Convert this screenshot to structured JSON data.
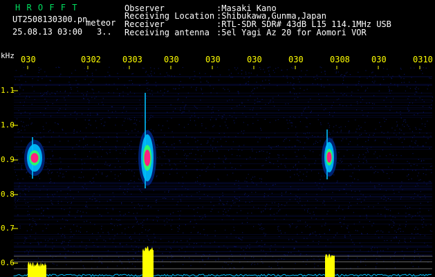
{
  "header": {
    "program": "H R O F F T",
    "filename": "UT2508130300.pn",
    "mode": "meteor",
    "datetime": "25.08.13 03:00",
    "count": "3..",
    "info_labels": [
      "Observer",
      "Receiving Location",
      "Receiver",
      "Receiving antenna"
    ],
    "info_values": [
      ":Masaki Kano",
      ":Shibukawa,Gunma,Japan",
      ":RTL-SDR SDR# 43dB L15 114.1MHz USB",
      ":5el Yagi Az 20 for Aomori VOR"
    ]
  },
  "axis": {
    "unit": "kHz",
    "y_ticks": [
      "1.1",
      "1.0",
      "0.9",
      "0.8",
      "0.7",
      "0.6"
    ],
    "time_ticks": [
      "030",
      "0302",
      "0303",
      "030",
      "030",
      "030",
      "030",
      "0308",
      "030",
      "0310"
    ]
  },
  "colors": {
    "background": "#000000",
    "axis": "#ffff00",
    "noise": "#1020a0",
    "echo_core": "#ff2080",
    "echo_edge": "#00c0ff",
    "power_trace": "#ffff00",
    "baseline": "#00c0ff"
  },
  "echoes": [
    {
      "time_label": "0300",
      "freq_khz": 0.9
    },
    {
      "time_label": "0303",
      "freq_khz": 0.9
    },
    {
      "time_label": "0308",
      "freq_khz": 0.9
    }
  ]
}
